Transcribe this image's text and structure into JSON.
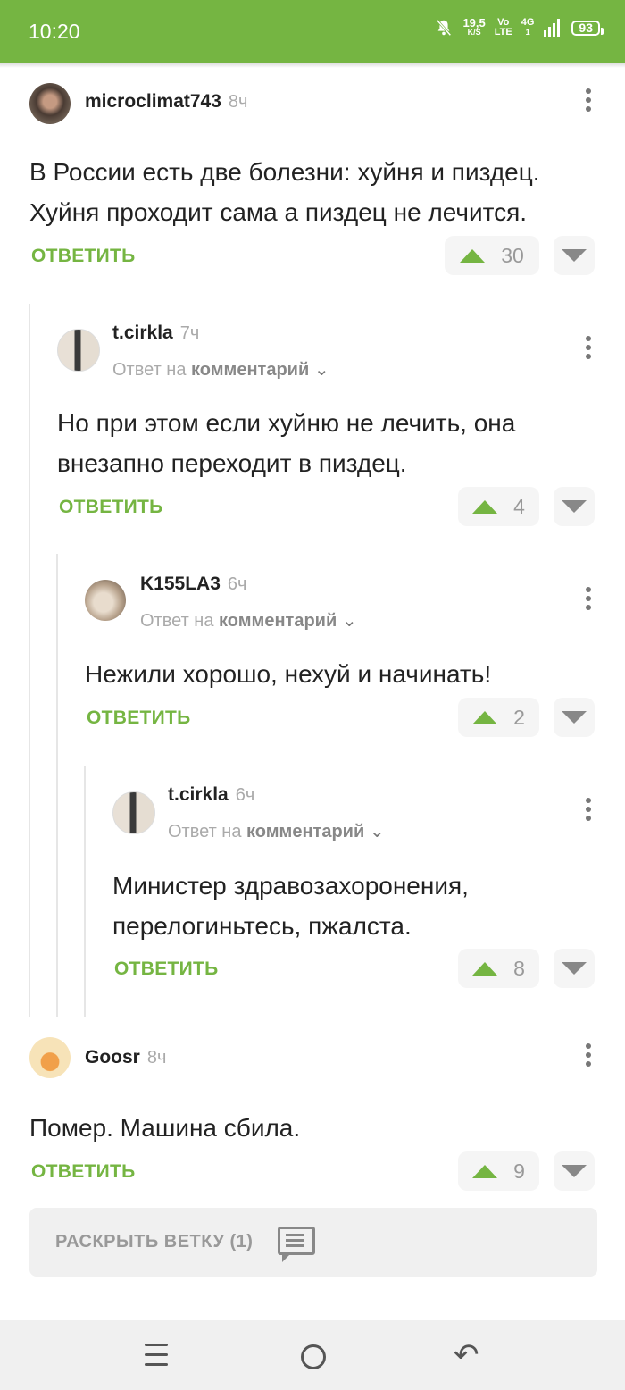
{
  "status_bar": {
    "time": "10:20",
    "speed_value": "19,5",
    "speed_unit": "K/S",
    "volte_top": "Vo",
    "volte_bottom": "LTE",
    "network": "4G",
    "network_sub": "1",
    "battery": "93",
    "background": "#75b542"
  },
  "comments": [
    {
      "user": "microclimat743",
      "time": "8ч",
      "reply_prefix": "",
      "reply_target": "",
      "text": "В России есть две болезни: хуйня и пиздец. Хуйня проходит сама а пиздец не лечится.",
      "reply_label": "ОТВЕТИТЬ",
      "votes": "30"
    },
    {
      "user": "t.cirkla",
      "time": "7ч",
      "reply_prefix": "Ответ на",
      "reply_target": "комментарий",
      "text": "Но при этом если хуйню не лечить, она внезапно переходит в пиздец.",
      "reply_label": "ОТВЕТИТЬ",
      "votes": "4"
    },
    {
      "user": "K155LA3",
      "time": "6ч",
      "reply_prefix": "Ответ на",
      "reply_target": "комментарий",
      "text": "Нежили хорошо, нехуй и начинать!",
      "reply_label": "ОТВЕТИТЬ",
      "votes": "2"
    },
    {
      "user": "t.cirkla",
      "time": "6ч",
      "reply_prefix": "Ответ на",
      "reply_target": "комментарий",
      "text": "Министер здравозахоронения, перелогиньтесь, пжалста.",
      "reply_label": "ОТВЕТИТЬ",
      "votes": "8"
    },
    {
      "user": "Goosr",
      "time": "8ч",
      "reply_prefix": "",
      "reply_target": "",
      "text": "Помер. Машина сбила.",
      "reply_label": "ОТВЕТИТЬ",
      "votes": "9"
    }
  ],
  "expand_thread": {
    "label": "РАСКРЫТЬ ВЕТКУ (1)"
  },
  "colors": {
    "accent": "#75b542",
    "vote_bg": "#f5f5f5",
    "muted": "#aaaaaa"
  },
  "nav_bar": {
    "icons": [
      "menu-icon",
      "home-icon",
      "back-icon"
    ]
  }
}
